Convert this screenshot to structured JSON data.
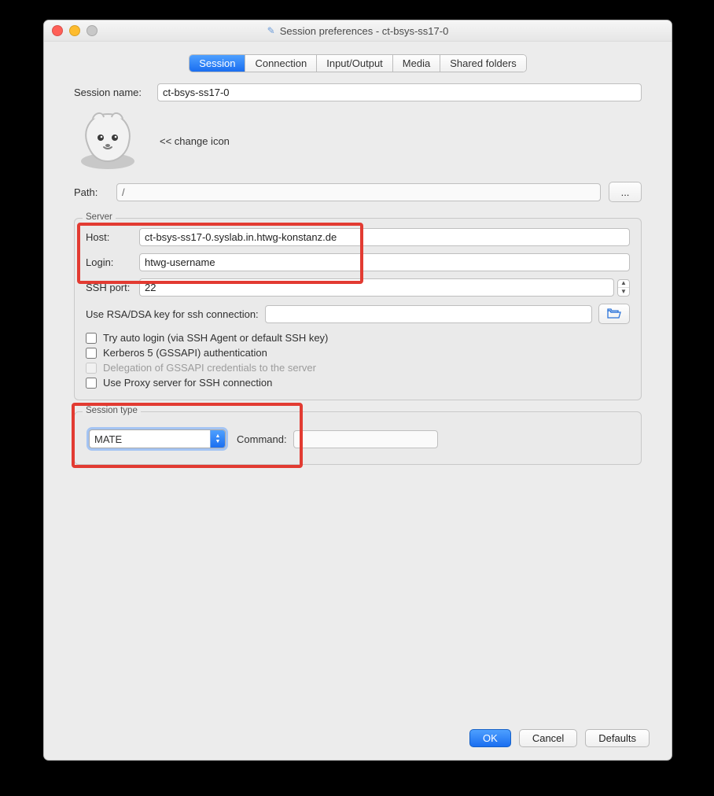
{
  "window": {
    "title": "Session preferences - ct-bsys-ss17-0"
  },
  "tabs": {
    "session": "Session",
    "connection": "Connection",
    "io": "Input/Output",
    "media": "Media",
    "shared": "Shared folders"
  },
  "session_name": {
    "label": "Session name:",
    "value": "ct-bsys-ss17-0"
  },
  "change_icon": "<< change icon",
  "path": {
    "label": "Path:",
    "value": "/",
    "browse": "..."
  },
  "server": {
    "legend": "Server",
    "host": {
      "label": "Host:",
      "value": "ct-bsys-ss17-0.syslab.in.htwg-konstanz.de"
    },
    "login": {
      "label": "Login:",
      "value": "htwg-username"
    },
    "ssh_port": {
      "label": "SSH port:",
      "value": "22"
    },
    "rsa_key": {
      "label": "Use RSA/DSA key for ssh connection:",
      "value": ""
    },
    "auto_login": "Try auto login (via SSH Agent or default SSH key)",
    "kerberos": "Kerberos 5 (GSSAPI) authentication",
    "delegation": "Delegation of GSSAPI credentials to the server",
    "proxy": "Use Proxy server for SSH connection"
  },
  "session_type": {
    "legend": "Session type",
    "value": "MATE",
    "command_label": "Command:",
    "command_value": ""
  },
  "buttons": {
    "ok": "OK",
    "cancel": "Cancel",
    "defaults": "Defaults"
  }
}
